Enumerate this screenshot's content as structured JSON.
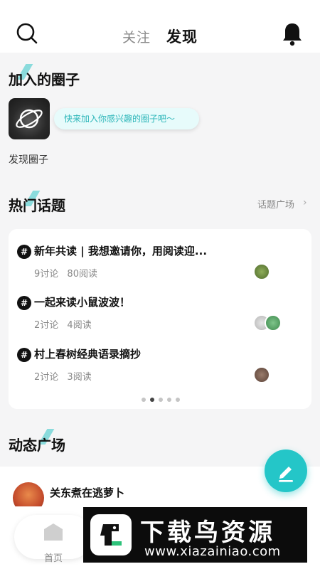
{
  "header": {
    "tabs": [
      {
        "label": "关注",
        "active": false
      },
      {
        "label": "发现",
        "active": true
      }
    ],
    "search_icon": "search-icon",
    "bell_icon": "bell-icon"
  },
  "joined_circles": {
    "title": "加入的圈子",
    "tooltip": "快来加入你感兴趣的圈子吧～",
    "discover_label": "发现圈子"
  },
  "hot_topics": {
    "title": "热门话题",
    "more_label": "话题广场",
    "items": [
      {
        "title": "新年共读 | 我想邀请你，用阅读迎...",
        "discussions": "9讨论",
        "reads": "80阅读"
      },
      {
        "title": "一起来读小鼠波波！",
        "discussions": "2讨论",
        "reads": "4阅读"
      },
      {
        "title": "村上春树经典语录摘抄",
        "discussions": "2讨论",
        "reads": "3阅读"
      }
    ],
    "pagination": {
      "total": 5,
      "current": 2
    }
  },
  "feed": {
    "title": "动态广场",
    "first_post_user": "关东煮在逃萝卜"
  },
  "bottom_nav": {
    "home_label": "首页"
  },
  "watermark": {
    "title": "下载鸟资源",
    "url": "www.xiazainiao.com"
  },
  "colors": {
    "accent": "#24c6c8",
    "background": "#f5f5f6"
  }
}
